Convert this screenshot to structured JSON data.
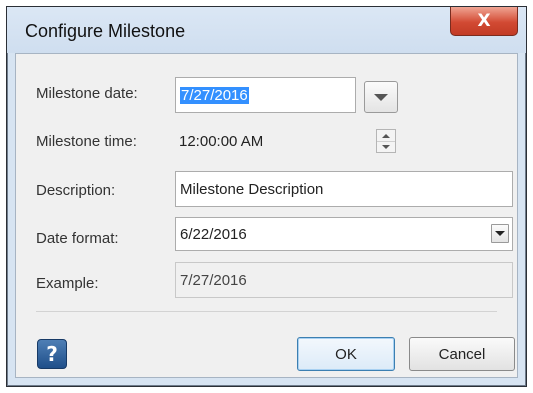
{
  "window": {
    "title": "Configure Milestone",
    "close_label": "X"
  },
  "fields": {
    "milestone_date": {
      "label": "Milestone date:",
      "value": "7/27/2016"
    },
    "milestone_time": {
      "label": "Milestone time:",
      "value": "12:00:00 AM"
    },
    "description": {
      "label": "Description:",
      "value": "Milestone Description"
    },
    "date_format": {
      "label": "Date format:",
      "value": "6/22/2016"
    },
    "example": {
      "label": "Example:",
      "value": "7/27/2016"
    }
  },
  "buttons": {
    "help_label": "?",
    "ok_label": "OK",
    "cancel_label": "Cancel"
  },
  "icons": {
    "close": "close-icon",
    "date_dropdown": "chevron-down-icon",
    "time_spinner": "spinner-icon",
    "format_dropdown": "chevron-down-icon",
    "help": "help-icon"
  },
  "colors": {
    "title_bar": "#d7e4f2",
    "close_button": "#d24a33",
    "selection": "#3390ff",
    "help_button": "#1f4f8a"
  }
}
